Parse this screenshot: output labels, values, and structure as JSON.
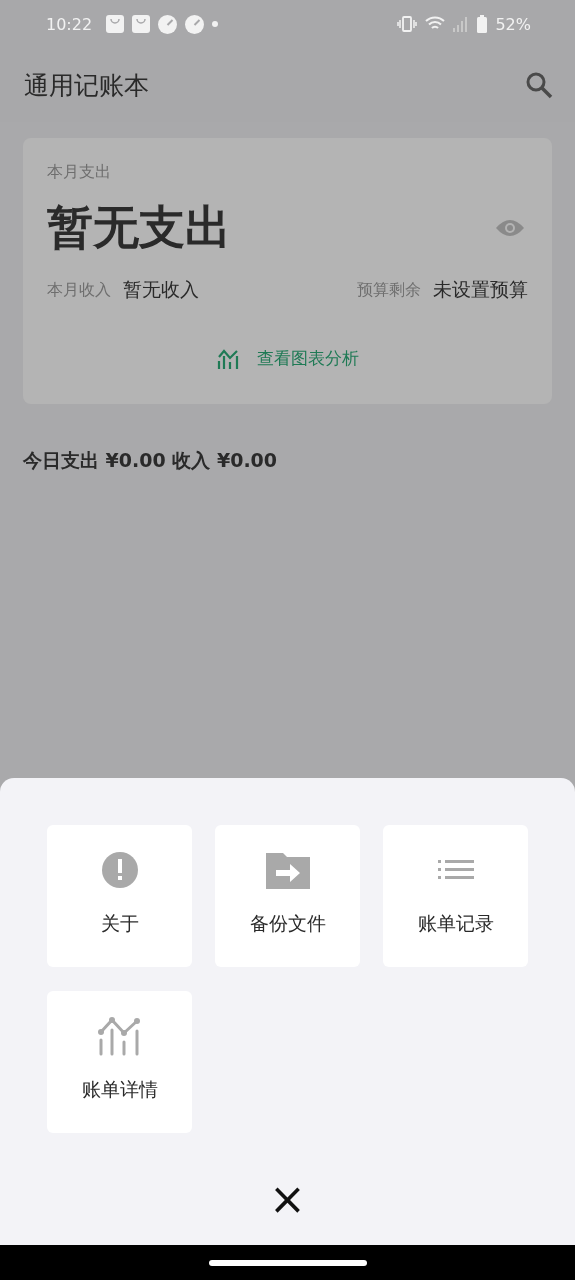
{
  "status_bar": {
    "time": "10:22",
    "battery": "52%"
  },
  "app_bar": {
    "title": "通用记账本"
  },
  "summary_card": {
    "label": "本月支出",
    "amount": "暂无支出",
    "income_label": "本月收入",
    "income_value": "暂无收入",
    "budget_label": "预算剩余",
    "budget_value": "未设置预算",
    "chart_link": "查看图表分析"
  },
  "today": "今日支出 ¥0.00 收入 ¥0.00",
  "menu_sheet": {
    "items": [
      {
        "kind": "info",
        "label": "关于"
      },
      {
        "kind": "folder",
        "label": "备份文件"
      },
      {
        "kind": "list",
        "label": "账单记录"
      },
      {
        "kind": "chart",
        "label": "账单详情"
      }
    ],
    "close": "×"
  }
}
